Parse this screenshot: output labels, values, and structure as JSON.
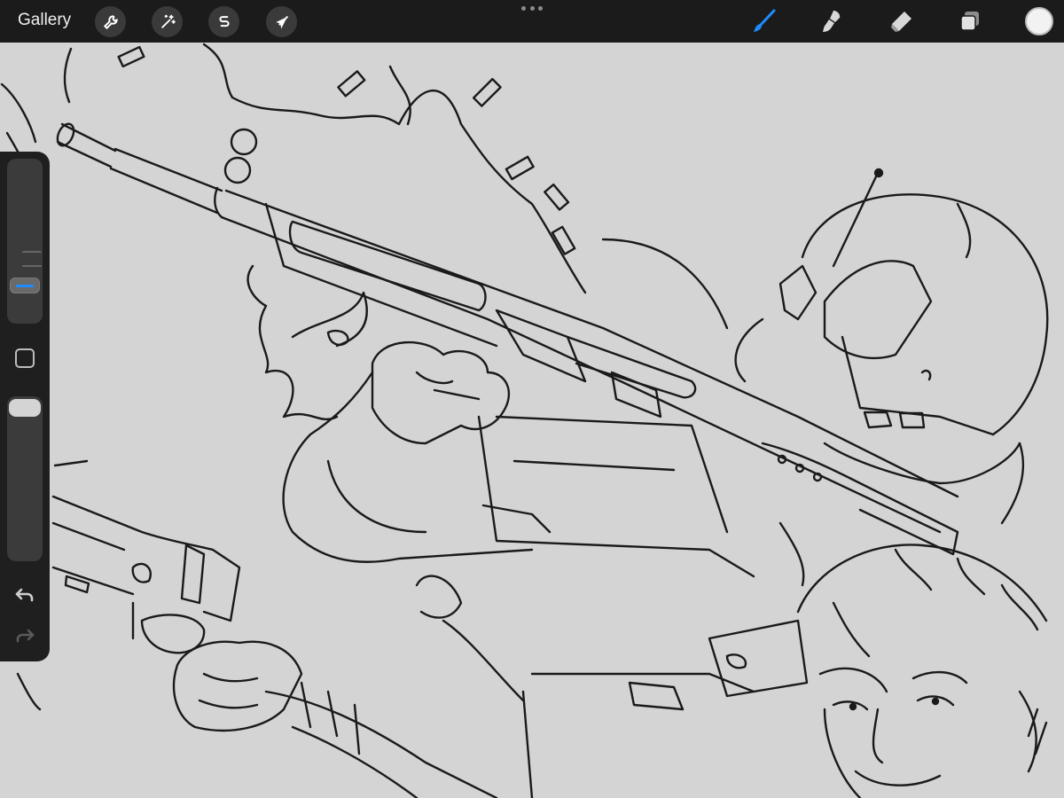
{
  "toolbar": {
    "gallery_label": "Gallery",
    "left_tools": [
      {
        "name": "actions",
        "icon": "wrench-icon"
      },
      {
        "name": "adjustments",
        "icon": "magic-wand-icon"
      },
      {
        "name": "selection",
        "icon": "selection-s-icon"
      },
      {
        "name": "transform",
        "icon": "arrow-cursor-icon"
      }
    ],
    "right_tools": [
      {
        "name": "brush",
        "icon": "brush-icon",
        "active": true
      },
      {
        "name": "smudge",
        "icon": "smudge-icon",
        "active": false
      },
      {
        "name": "eraser",
        "icon": "eraser-icon",
        "active": false
      },
      {
        "name": "layers",
        "icon": "layers-icon",
        "active": false
      }
    ],
    "current_color": "#f2f2f2",
    "active_color": "#1f8bff"
  },
  "sidebar": {
    "brush_size_level": 0.2,
    "brush_opacity_level": 1.0,
    "undo_icon": "undo-arrow-icon",
    "redo_icon": "redo-arrow-icon",
    "modify_icon": "square-modify-icon"
  },
  "canvas": {
    "background": "#d4d4d4",
    "stroke_color": "#1a1a1a"
  }
}
